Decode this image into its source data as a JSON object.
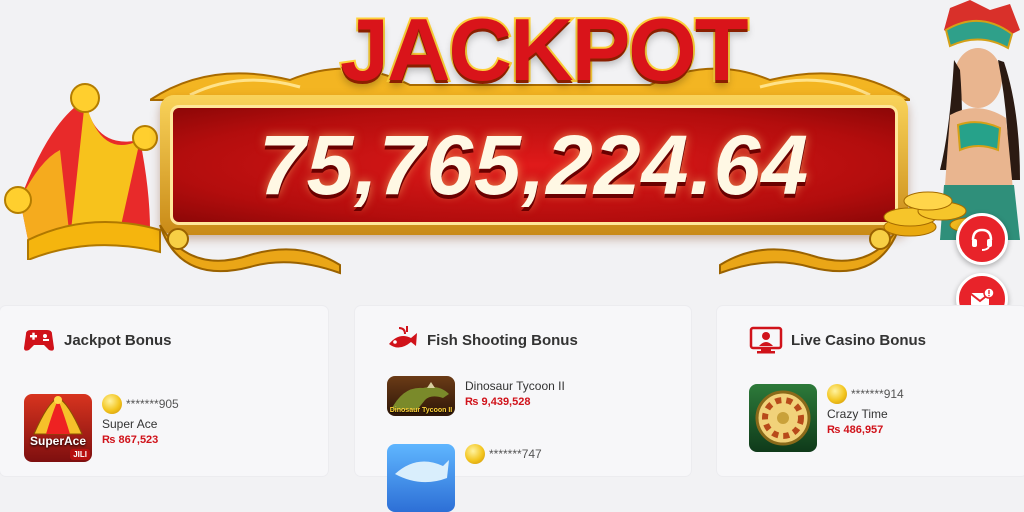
{
  "jackpot": {
    "title": "JACKPOT",
    "amount": "75,765,224.64"
  },
  "fabs": {
    "support_icon": "headset-icon",
    "mail_icon": "mail-alert-icon"
  },
  "sections": [
    {
      "title": "Jackpot Bonus",
      "icon": "gamepad-icon",
      "entries": [
        {
          "user": "*******905",
          "game": "Super Ace",
          "amount": "₨ 867,523",
          "thumb_text": "SuperAce",
          "thumb_badge": "JILI"
        }
      ]
    },
    {
      "title": "Fish Shooting Bonus",
      "icon": "fish-icon",
      "entries": [
        {
          "game": "Dinosaur Tycoon II",
          "amount": "₨ 9,439,528",
          "thumb_text": "Dinosaur Tycoon II"
        },
        {
          "user": "*******747"
        }
      ]
    },
    {
      "title": "Live Casino Bonus",
      "icon": "live-dealer-icon",
      "entries": [
        {
          "user": "*******914",
          "game": "Crazy Time",
          "amount": "₨ 486,957"
        }
      ]
    }
  ],
  "colors": {
    "accent_red": "#e8232a",
    "amount_red": "#d0121a",
    "gold": "#f3c51e"
  }
}
